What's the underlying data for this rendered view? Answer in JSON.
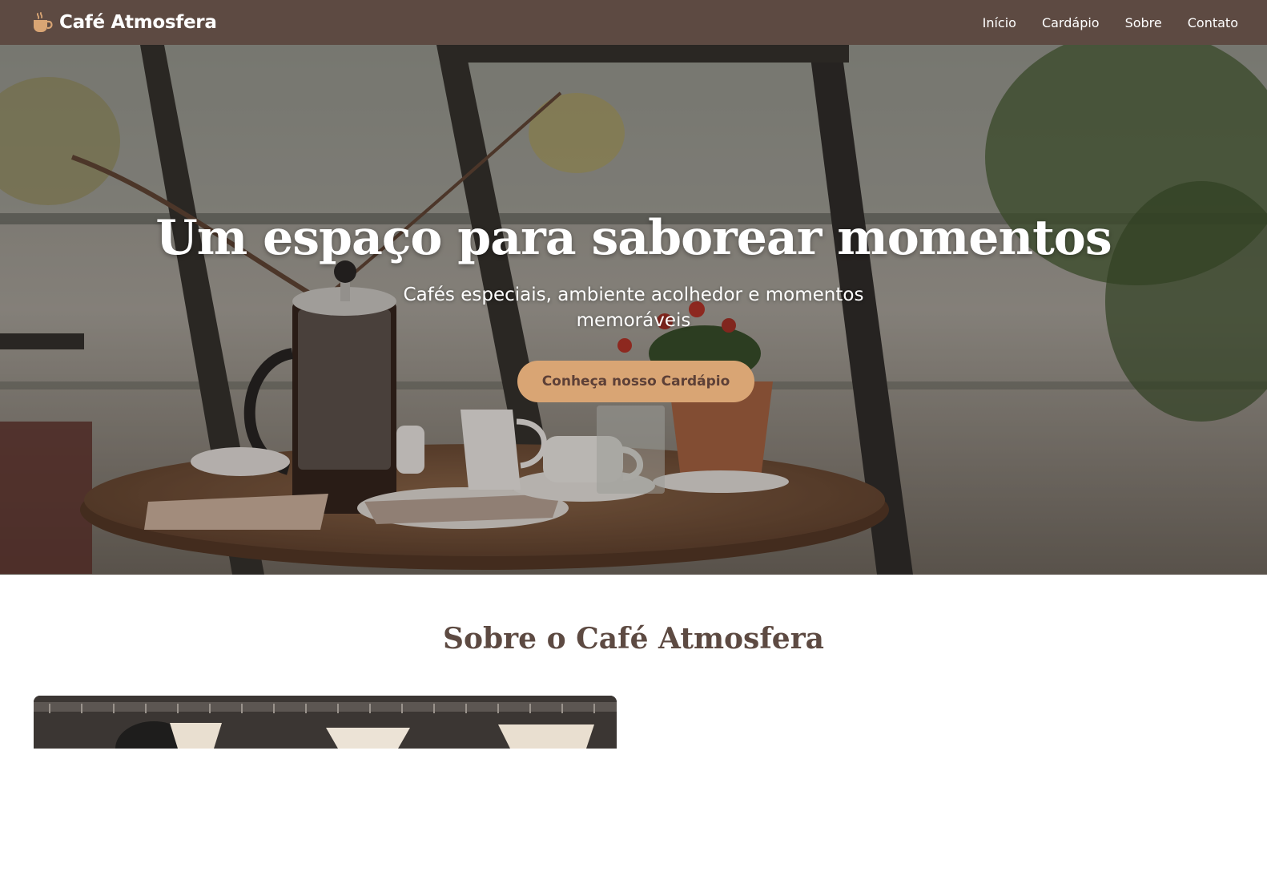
{
  "navbar": {
    "brand": "Café Atmosfera",
    "brand_icon": "coffee-cup-icon",
    "links": [
      {
        "label": "Início"
      },
      {
        "label": "Cardápio"
      },
      {
        "label": "Sobre"
      },
      {
        "label": "Contato"
      }
    ]
  },
  "hero": {
    "title": "Um espaço para saborear momentos",
    "subtitle": "Cafés especiais, ambiente acolhedor e momentos memoráveis",
    "cta_label": "Conheça nosso Cardápio"
  },
  "about": {
    "title": "Sobre o Café Atmosfera"
  },
  "colors": {
    "navbar_bg": "#5d4a42",
    "accent": "#d9a574",
    "heading": "#5d4a42"
  }
}
